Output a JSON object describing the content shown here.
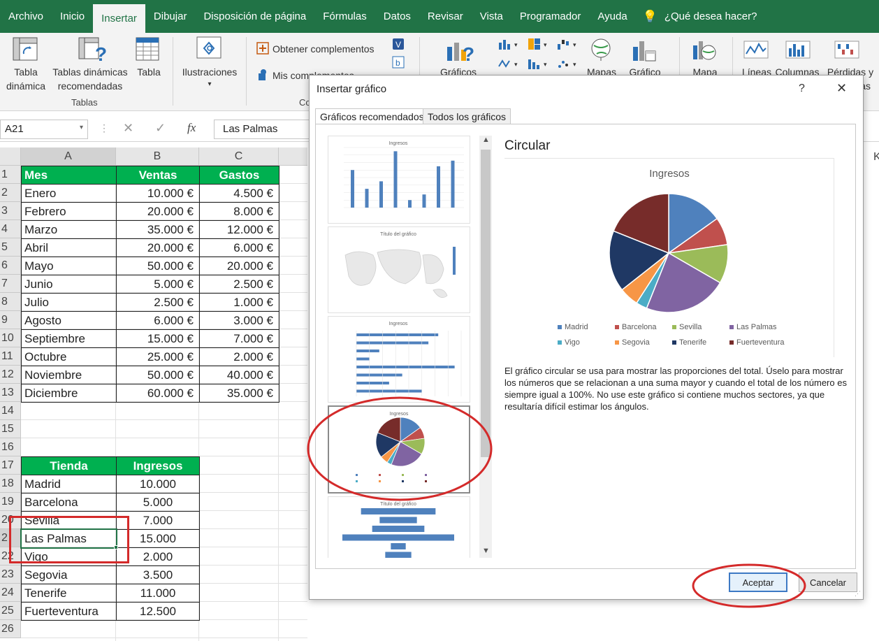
{
  "menu": {
    "items": [
      "Archivo",
      "Inicio",
      "Insertar",
      "Dibujar",
      "Disposición de página",
      "Fórmulas",
      "Datos",
      "Revisar",
      "Vista",
      "Programador",
      "Ayuda"
    ],
    "active_index": 2,
    "search_prompt": "¿Qué desea hacer?"
  },
  "ribbon": {
    "pivot_label_1": "Tabla",
    "pivot_label_2": "dinámica",
    "recpivot_label_1": "Tablas dinámicas",
    "recpivot_label_2": "recomendadas",
    "table_label": "Tabla",
    "group_tables": "Tablas",
    "illustrations_label": "Ilustraciones",
    "get_addins": "Obtener complementos",
    "my_addins": "Mis complementos",
    "group_addins_partial": "Co",
    "charts_label": "Gráficos",
    "maps_label": "Mapas",
    "pivotchart_label": "Gráfico",
    "map3d_label": "Mapa",
    "lines_label": "Líneas",
    "columns_label": "Columnas",
    "winloss_label_1": "Pérdidas y",
    "winloss_label_2": "as"
  },
  "formula_bar": {
    "name_box": "A21",
    "value": "Las Palmas",
    "fx": "fx"
  },
  "grid": {
    "columns": [
      "A",
      "B",
      "C"
    ],
    "hidden_col_right": "K",
    "table1_header": [
      "Mes",
      "Ventas",
      "Gastos"
    ],
    "table1_rows": [
      [
        "Enero",
        "10.000 €",
        "4.500 €"
      ],
      [
        "Febrero",
        "20.000 €",
        "8.000 €"
      ],
      [
        "Marzo",
        "35.000 €",
        "12.000 €"
      ],
      [
        "Abril",
        "20.000 €",
        "6.000 €"
      ],
      [
        "Mayo",
        "50.000 €",
        "20.000 €"
      ],
      [
        "Junio",
        "5.000 €",
        "2.500 €"
      ],
      [
        "Julio",
        "2.500 €",
        "1.000 €"
      ],
      [
        "Agosto",
        "6.000 €",
        "3.000 €"
      ],
      [
        "Septiembre",
        "15.000 €",
        "7.000 €"
      ],
      [
        "Octubre",
        "25.000 €",
        "2.000 €"
      ],
      [
        "Noviembre",
        "50.000 €",
        "40.000 €"
      ],
      [
        "Diciembre",
        "60.000 €",
        "35.000 €"
      ]
    ],
    "table2_header": [
      "Tienda",
      "Ingresos"
    ],
    "table2_rows": [
      [
        "Madrid",
        "10.000"
      ],
      [
        "Barcelona",
        "5.000"
      ],
      [
        "Sevilla",
        "7.000"
      ],
      [
        "Las Palmas",
        "15.000"
      ],
      [
        "Vigo",
        "2.000"
      ],
      [
        "Segovia",
        "3.500"
      ],
      [
        "Tenerife",
        "11.000"
      ],
      [
        "Fuerteventura",
        "12.500"
      ]
    ],
    "row_numbers": [
      "1",
      "2",
      "3",
      "4",
      "5",
      "6",
      "7",
      "8",
      "9",
      "10",
      "11",
      "12",
      "13",
      "14",
      "15",
      "16",
      "17",
      "18",
      "19",
      "20",
      "2",
      "22",
      "23",
      "24",
      "25",
      "26"
    ]
  },
  "dialog": {
    "title": "Insertar gráfico",
    "help": "?",
    "close": "✕",
    "tabs": [
      "Gráficos recomendados",
      "Todos los gráficos"
    ],
    "preview_title": "Circular",
    "description": "El gráfico circular se usa para mostrar las proporciones del total. Úselo para mostrar los números que se relacionan a una suma mayor y cuando el total de los número es siempre igual a 100%. No use este gráfico si contiene muchos sectores, ya que resultaría difícil estimar los ángulos.",
    "ok": "Aceptar",
    "cancel": "Cancelar",
    "thumb_titles": [
      "Ingresos",
      "Título del gráfico",
      "Ingresos",
      "Ingresos",
      "Título del gráfico"
    ]
  },
  "colors": {
    "excel_green": "#217346",
    "header_green": "#00b050",
    "annotation_red": "#d42a2a",
    "selection_green": "#217346"
  },
  "chart_data": {
    "type": "pie",
    "title": "Ingresos",
    "categories": [
      "Madrid",
      "Barcelona",
      "Sevilla",
      "Las Palmas",
      "Vigo",
      "Segovia",
      "Tenerife",
      "Fuerteventura"
    ],
    "values": [
      10000,
      5000,
      7000,
      15000,
      2000,
      3500,
      11000,
      12500
    ],
    "colors": [
      "#4f81bd",
      "#c0504d",
      "#9bbb59",
      "#8064a2",
      "#4bacc6",
      "#f79646",
      "#1f3864",
      "#772c2a"
    ],
    "legend": "bottom"
  }
}
